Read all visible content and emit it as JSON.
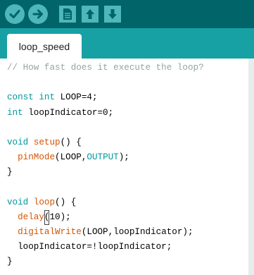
{
  "colors": {
    "toolbar_bg": "#006468",
    "toolbar_button": "#4db7bb",
    "tabbar_bg": "#17a1a5",
    "keyword": "#00979c",
    "function": "#d35400",
    "comment": "#95a5a6"
  },
  "toolbar": {
    "buttons": [
      {
        "name": "verify",
        "icon": "checkmark-icon"
      },
      {
        "name": "upload",
        "icon": "arrow-right-icon"
      },
      {
        "name": "new",
        "icon": "new-file-icon"
      },
      {
        "name": "open",
        "icon": "arrow-up-icon"
      },
      {
        "name": "save",
        "icon": "arrow-down-icon"
      }
    ]
  },
  "tab": {
    "label": "loop_speed"
  },
  "code": {
    "l1": "// How fast does it execute the loop?",
    "l3_kw1": "const",
    "l3_kw2": "int",
    "l3_rest": " LOOP=4;",
    "l4_kw": "int",
    "l4_rest": " loopIndicator=0;",
    "l6_kw": "void",
    "l6_fn": "setup",
    "l6_rest": "() {",
    "l7_fn": "pinMode",
    "l7_mid": "(LOOP,",
    "l7_const": "OUTPUT",
    "l7_end": ");",
    "l8": "}",
    "l10_kw": "void",
    "l10_fn": "loop",
    "l10_rest": "() {",
    "l11_fn": "delay",
    "l11_paren": "(",
    "l11_val": "10",
    "l11_end": ");",
    "l12_fn": "digitalWrite",
    "l12_rest": "(LOOP,loopIndicator);",
    "l13": "loopIndicator=!loopIndicator;",
    "l14": "}"
  }
}
